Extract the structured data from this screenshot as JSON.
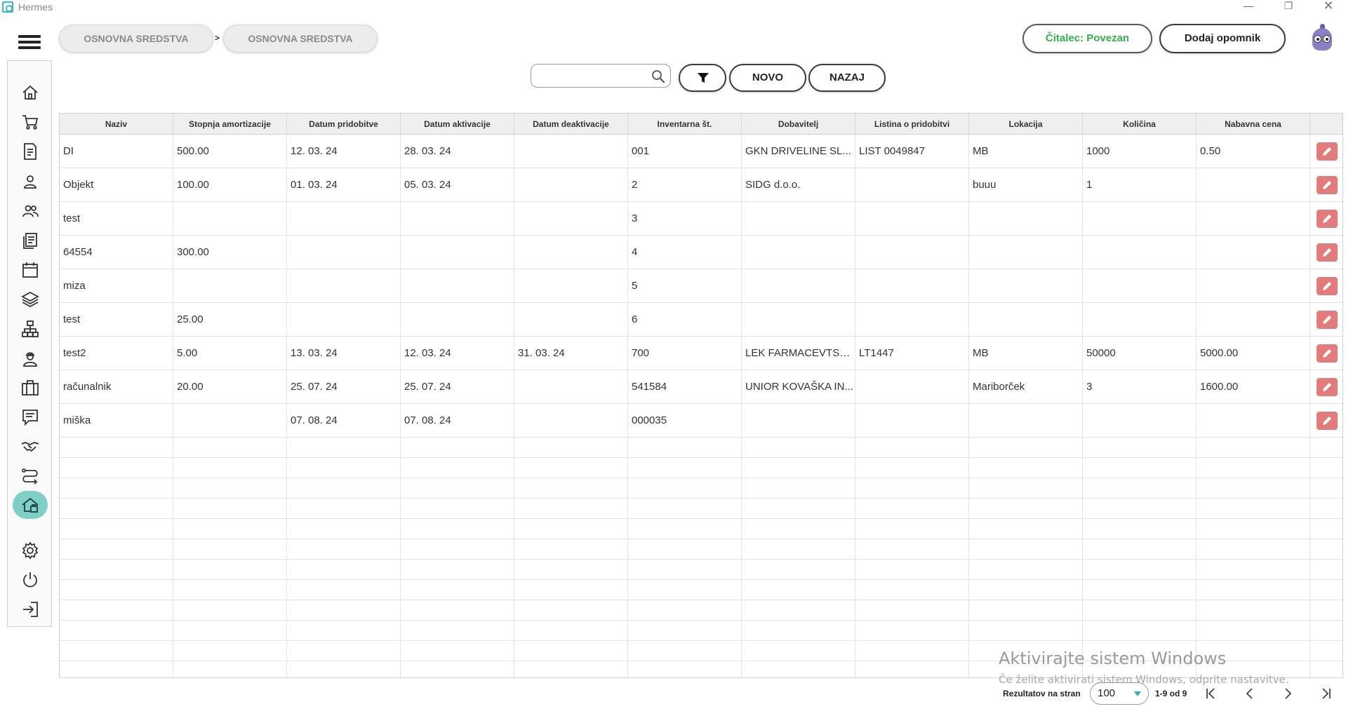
{
  "window": {
    "title": "Hermes",
    "minimize": "—",
    "maximize": "❐",
    "close": "✕"
  },
  "header": {
    "breadcrumbs": [
      "OSNOVNA SREDSTVA",
      "OSNOVNA SREDSTVA"
    ],
    "breadcrumb_separator": ">",
    "reader_status": "Čitalec: Povezan",
    "add_reminder": "Dodaj opomnik",
    "status_color": "#2fb24a"
  },
  "toolbar": {
    "search_value": "",
    "search_placeholder": "",
    "new_label": "NOVO",
    "back_label": "NAZAJ"
  },
  "sidebar": {
    "items": [
      {
        "icon": "home-icon"
      },
      {
        "icon": "cart-icon"
      },
      {
        "icon": "document-icon"
      },
      {
        "icon": "person-icon"
      },
      {
        "icon": "people-icon"
      },
      {
        "icon": "documents-icon"
      },
      {
        "icon": "calendar-icon"
      },
      {
        "icon": "layers-icon"
      },
      {
        "icon": "hierarchy-icon"
      },
      {
        "icon": "worker-icon"
      },
      {
        "icon": "briefcase-icon"
      },
      {
        "icon": "chat-icon"
      },
      {
        "icon": "handshake-icon"
      },
      {
        "icon": "route-icon"
      },
      {
        "icon": "assets-icon",
        "active": true
      },
      {
        "icon": "gear-icon"
      },
      {
        "icon": "power-icon"
      },
      {
        "icon": "logout-icon"
      }
    ],
    "active_color": "#7fcfc8"
  },
  "table": {
    "columns": [
      "Naziv",
      "Stopnja amortizacije",
      "Datum pridobitve",
      "Datum aktivacije",
      "Datum deaktivacije",
      "Inventarna št.",
      "Dobavitelj",
      "Listina o pridobitvi",
      "Lokacija",
      "Količina",
      "Nabavna cena"
    ],
    "rows": [
      [
        "DI",
        "500.00",
        "12. 03. 24",
        "28. 03. 24",
        "",
        "001",
        "GKN DRIVELINE SL...",
        "LIST 0049847",
        "MB",
        "1000",
        "0.50"
      ],
      [
        "Objekt",
        "100.00",
        "01. 03. 24",
        "05. 03. 24",
        "",
        "2",
        "SIDG d.o.o.",
        "",
        "buuu",
        "1",
        ""
      ],
      [
        "test",
        "",
        "",
        "",
        "",
        "3",
        "",
        "",
        "",
        "",
        ""
      ],
      [
        "64554",
        "300.00",
        "",
        "",
        "",
        "4",
        "",
        "",
        "",
        "",
        ""
      ],
      [
        "miza",
        "",
        "",
        "",
        "",
        "5",
        "",
        "",
        "",
        "",
        ""
      ],
      [
        "test",
        "25.00",
        "",
        "",
        "",
        "6",
        "",
        "",
        "",
        "",
        ""
      ],
      [
        "test2",
        "5.00",
        "13. 03. 24",
        "12. 03. 24",
        "31. 03. 24",
        "700",
        "LEK FARMACEVTSK...",
        "LT1447",
        "MB",
        "50000",
        "5000.00"
      ],
      [
        "računalnik",
        "20.00",
        "25. 07. 24",
        "25. 07. 24",
        "",
        "541584",
        "UNIOR KOVAŠKA IN...",
        "",
        "Mariborček",
        "3",
        "1600.00"
      ],
      [
        "miška",
        "",
        "07. 08. 24",
        "07. 08. 24",
        "",
        "000035",
        "",
        "",
        "",
        "",
        ""
      ]
    ],
    "edit_color": "#e27b7b"
  },
  "watermark": {
    "title": "Aktivirajte sistem Windows",
    "subtitle": "Če želite aktivirati sistem Windows, odprite nastavitve."
  },
  "pagination": {
    "per_page_label": "Rezultatov na stran",
    "per_page_value": "100",
    "range_info": "1-9 od 9"
  }
}
